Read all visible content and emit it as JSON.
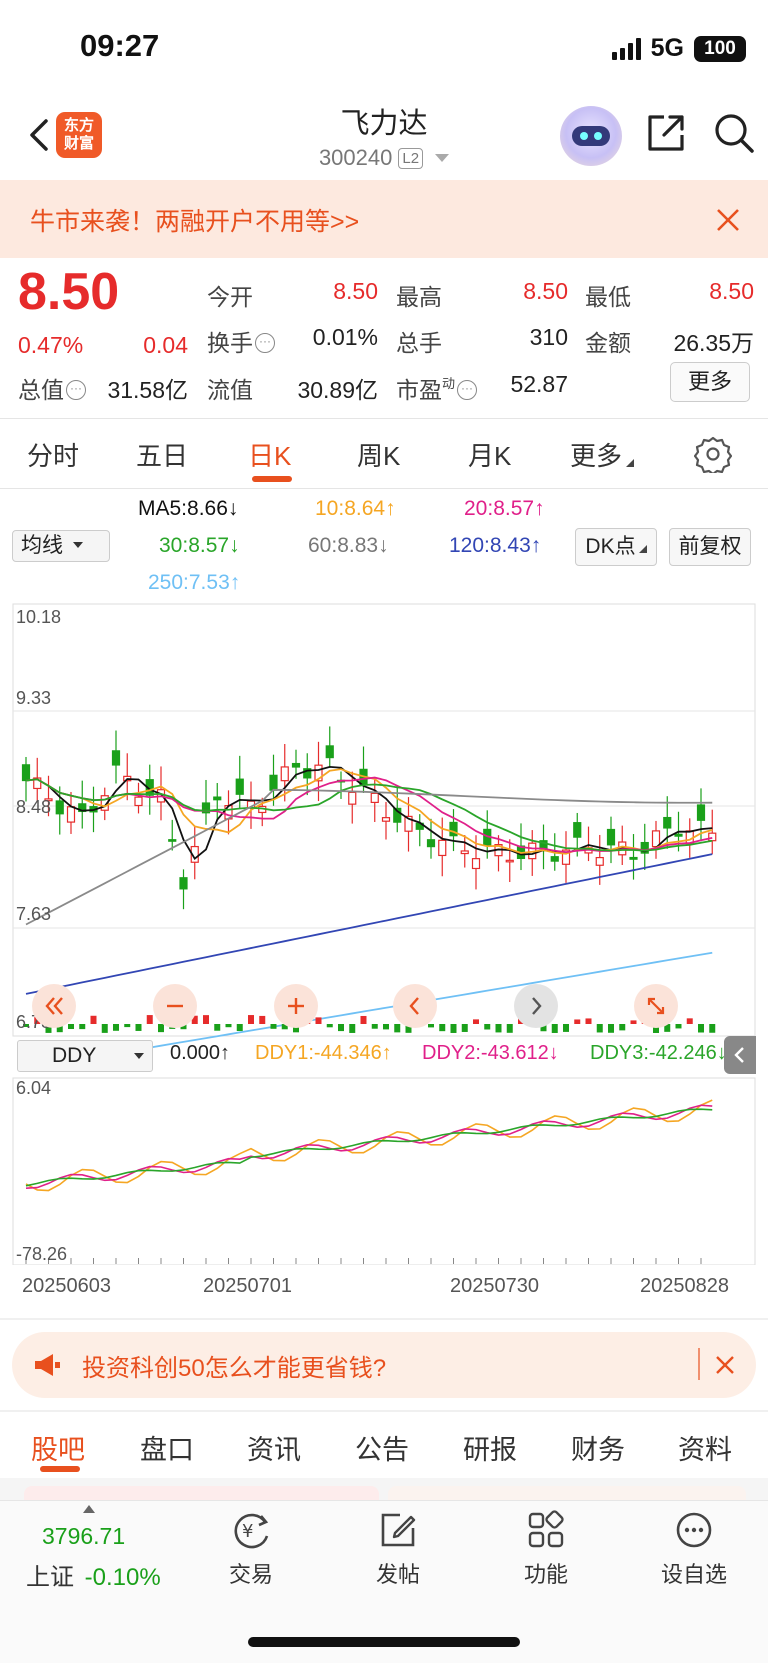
{
  "status": {
    "time": "09:27",
    "network": "5G",
    "battery": "100"
  },
  "header": {
    "logo_line1": "东方",
    "logo_line2": "财富",
    "stock_name": "飞力达",
    "stock_code": "300240",
    "level_badge": "L2"
  },
  "banner": {
    "text": "牛市来袭！两融开户不用等>>"
  },
  "quote": {
    "price": "8.50",
    "change_pct": "0.47%",
    "change": "0.04",
    "open_label": "今开",
    "open": "8.50",
    "high_label": "最高",
    "high": "8.50",
    "low_label": "最低",
    "low": "8.50",
    "turnover_label": "换手",
    "turnover": "0.01%",
    "volume_label": "总手",
    "volume": "310",
    "amount_label": "金额",
    "amount": "26.35万",
    "mktcap_label": "总值",
    "mktcap": "31.58亿",
    "float_label": "流值",
    "float": "30.89亿",
    "pe_label": "市盈",
    "pe_sup": "动",
    "pe": "52.87",
    "more_button": "更多"
  },
  "tabs": [
    "分时",
    "五日",
    "日K",
    "周K",
    "月K",
    "更多"
  ],
  "ma": {
    "ma5": "MA5:8.66↓",
    "ma10": "10:8.64↑",
    "ma20": "20:8.57↑",
    "ma30": "30:8.57↓",
    "ma60": "60:8.83↓",
    "ma120": "120:8.43↑",
    "ma250": "250:7.53↑",
    "select_label": "均线",
    "dk_button": "DK点",
    "adjust_button": "前复权"
  },
  "colors": {
    "accent": "#e8501e",
    "up": "#e62b2b",
    "down": "#1aa01a",
    "ma5": "#111111",
    "ma10": "#f5a623",
    "ma20": "#e0208a",
    "ma30": "#2aa52a",
    "ma60": "#8a8a8a",
    "ma120": "#3246b4",
    "ma250": "#6fc0f5"
  },
  "axis": {
    "y1": "10.18",
    "y2": "9.33",
    "y3": "8.48",
    "y4": "7.63",
    "y5": "6.78",
    "ddy_top": "6.04",
    "ddy_bottom": "-78.26"
  },
  "ddy": {
    "select_label": "DDY",
    "value": "0.000↑",
    "ddy1": "DDY1:-44.346↑",
    "ddy2": "DDY2:-43.612↓",
    "ddy3": "DDY3:-42.246↓"
  },
  "dates": [
    "20250603",
    "20250701",
    "20250730",
    "20250828"
  ],
  "promo": {
    "text": "投资科创50怎么才能更省钱?"
  },
  "bottom_tabs": [
    "股吧",
    "盘口",
    "资讯",
    "公告",
    "研报",
    "财务",
    "资料"
  ],
  "index": {
    "value": "3796.71",
    "name": "上证",
    "change": "-0.10%"
  },
  "nav": {
    "trade": "交易",
    "post": "发帖",
    "functions": "功能",
    "watchlist": "设自选"
  }
}
